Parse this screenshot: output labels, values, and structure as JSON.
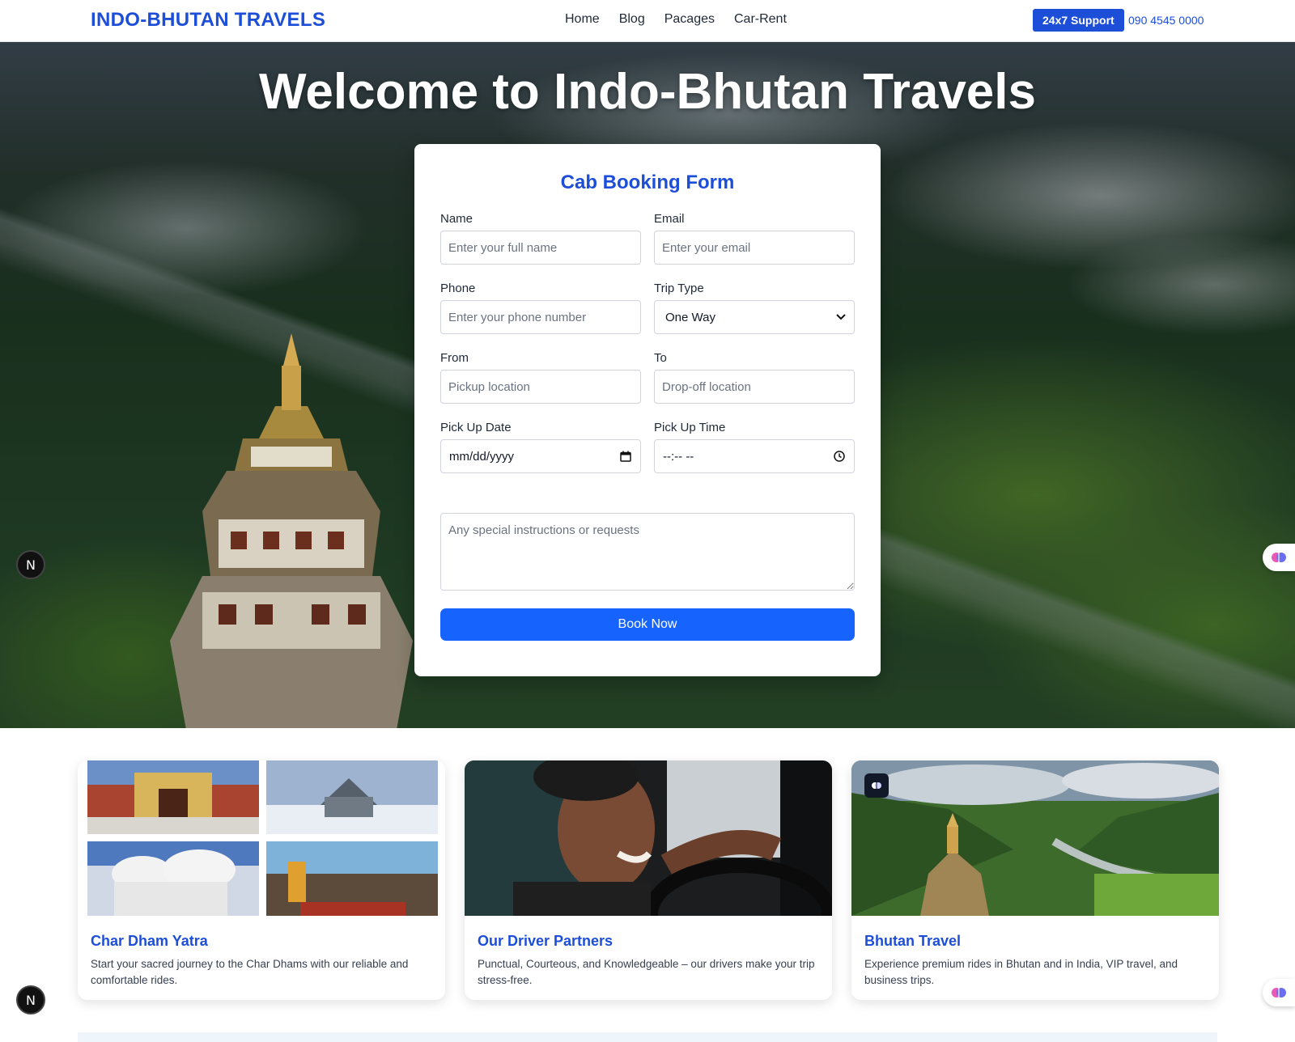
{
  "navbar": {
    "brand": "INDO-BHUTAN TRAVELS",
    "links": [
      "Home",
      "Blog",
      "Pacages",
      "Car-Rent"
    ],
    "support_label": "24x7 Support",
    "phone": "090 4545 0000"
  },
  "hero": {
    "title": "Welcome to Indo-Bhutan Travels"
  },
  "form": {
    "title": "Cab Booking Form",
    "name": {
      "label": "Name",
      "placeholder": "Enter your full name"
    },
    "email": {
      "label": "Email",
      "placeholder": "Enter your email"
    },
    "phone": {
      "label": "Phone",
      "placeholder": "Enter your phone number"
    },
    "trip_type": {
      "label": "Trip Type",
      "value": "One Way"
    },
    "from": {
      "label": "From",
      "placeholder": "Pickup location"
    },
    "to": {
      "label": "To",
      "placeholder": "Drop-off location"
    },
    "pickup_date": {
      "label": "Pick Up Date",
      "value": "mm/dd/yyyy"
    },
    "pickup_time": {
      "label": "Pick Up Time",
      "value": "--:-- --"
    },
    "instructions": {
      "placeholder": "Any special instructions or requests"
    },
    "submit_label": "Book Now"
  },
  "widgets": {
    "n_badge": "N"
  },
  "cards": [
    {
      "title": "Char Dham Yatra",
      "description": "Start your sacred journey to the Char Dhams with our reliable and comfortable rides."
    },
    {
      "title": "Our Driver Partners",
      "description": "Punctual, Courteous, and Knowledgeable – our drivers make your trip stress-free."
    },
    {
      "title": "Bhutan Travel",
      "description": "Experience premium rides in Bhutan and in India, VIP travel, and business trips."
    }
  ],
  "colors": {
    "brand": "#1d4ed8",
    "button": "#1763fe"
  }
}
